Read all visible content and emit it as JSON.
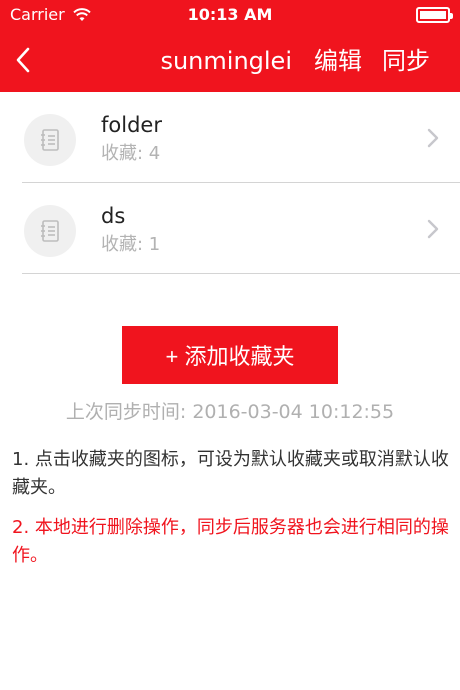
{
  "status_bar": {
    "carrier": "Carrier",
    "time": "10:13 AM"
  },
  "navbar": {
    "title": "sunminglei",
    "edit_label": "编辑",
    "sync_label": "同步"
  },
  "folders": [
    {
      "name": "folder",
      "count_label": "收藏: 4"
    },
    {
      "name": "ds",
      "count_label": "收藏: 1"
    }
  ],
  "add_button_label": "+ 添加收藏夹",
  "last_sync": "上次同步时间:  2016-03-04 10:12:55",
  "notes": {
    "note1": "1. 点击收藏夹的图标，可设为默认收藏夹或取消默认收藏夹。",
    "note2": "2. 本地进行删除操作，同步后服务器也会进行相同的操作。"
  },
  "colors": {
    "accent": "#f0141e",
    "muted": "#b3b3b3"
  },
  "icons": {
    "back": "chevron-left-icon",
    "row_icon": "notebook-icon",
    "row_disclosure": "chevron-right-icon"
  }
}
